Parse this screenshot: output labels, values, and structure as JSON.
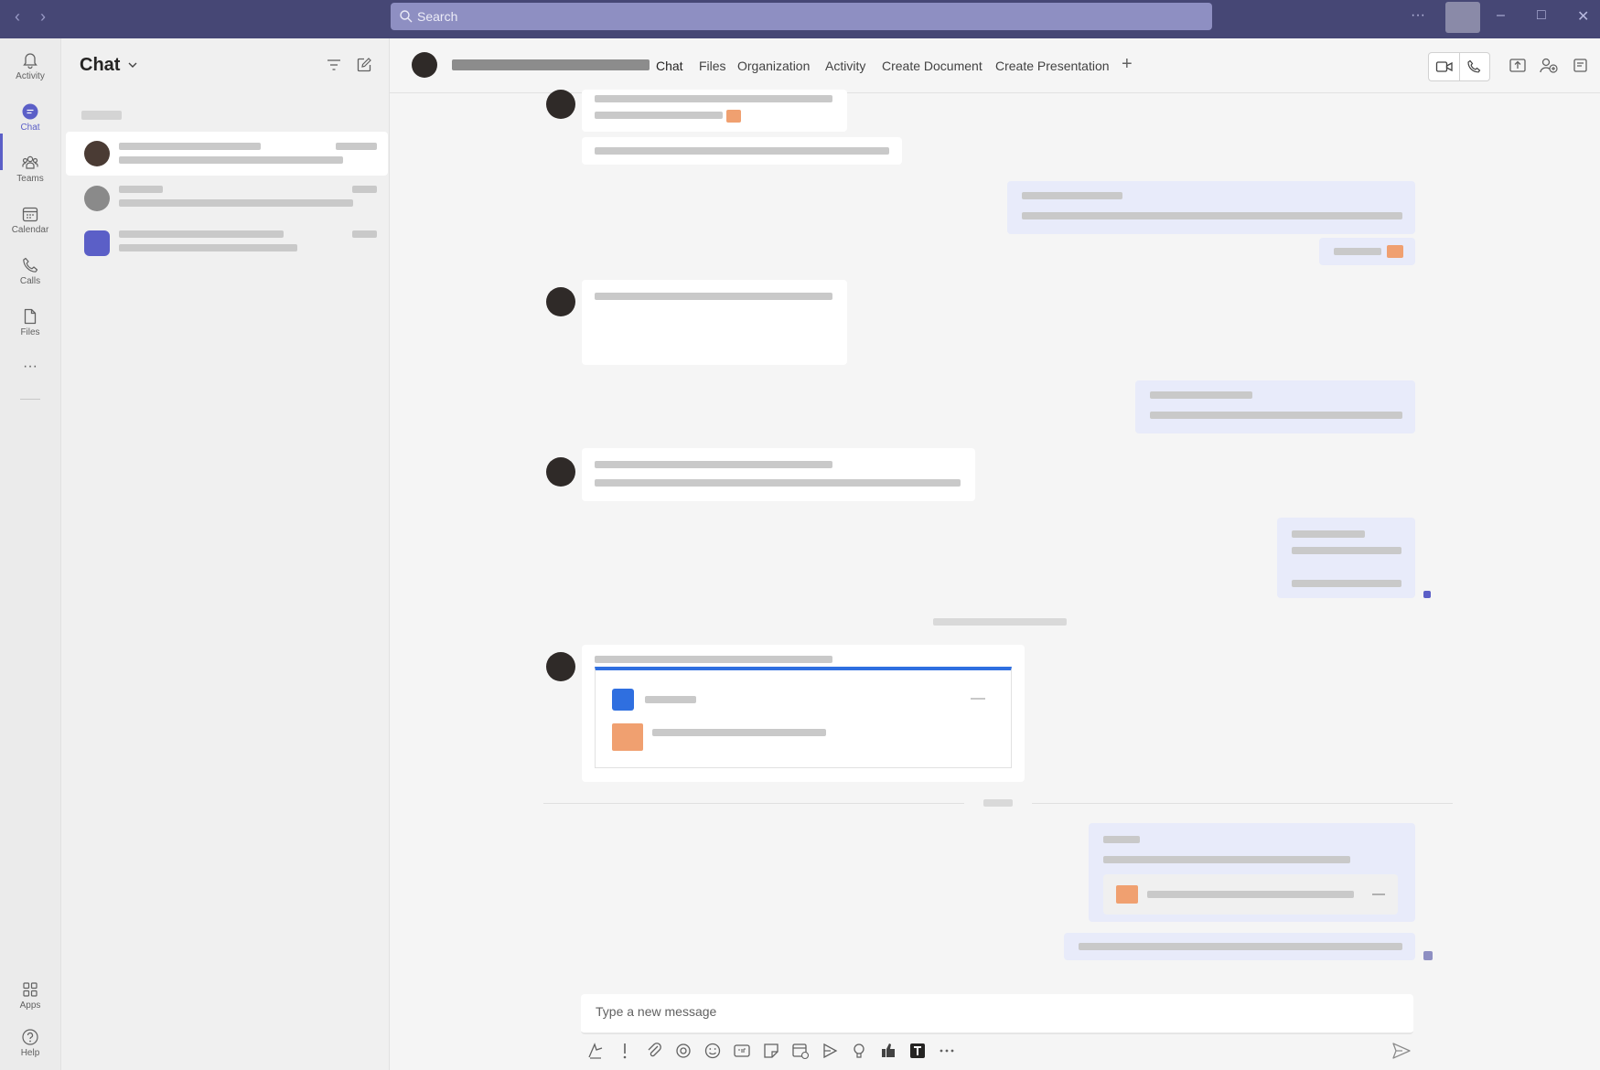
{
  "topbar": {
    "search_placeholder": "Search",
    "more_label": "···",
    "minimize_label": "–",
    "maximize_label": "□",
    "close_label": "✕",
    "back_label": "‹",
    "forward_label": "›"
  },
  "rail": {
    "items": [
      {
        "label": "Activity",
        "icon": "bell-icon"
      },
      {
        "label": "Chat",
        "icon": "chat-icon"
      },
      {
        "label": "Teams",
        "icon": "teams-icon"
      },
      {
        "label": "Calendar",
        "icon": "calendar-icon"
      },
      {
        "label": "Calls",
        "icon": "phone-icon"
      },
      {
        "label": "Files",
        "icon": "file-icon"
      }
    ],
    "more_label": "···",
    "apps_label": "Apps",
    "help_label": "Help",
    "accent_color": "#5b5fc7"
  },
  "chatlist": {
    "title": "Chat"
  },
  "header": {
    "tabs": [
      {
        "label": "Chat",
        "active": true
      },
      {
        "label": "Files"
      },
      {
        "label": "Organization"
      },
      {
        "label": "Activity"
      },
      {
        "label": "Create Document"
      },
      {
        "label": "Create Presentation"
      }
    ],
    "add_tab_label": "+"
  },
  "composer": {
    "placeholder": "Type a new message"
  },
  "colors": {
    "titlebar": "#464775",
    "search": "#8e8fc2",
    "accent": "#5b5fc7",
    "my_bubble": "#e8ebfa"
  }
}
